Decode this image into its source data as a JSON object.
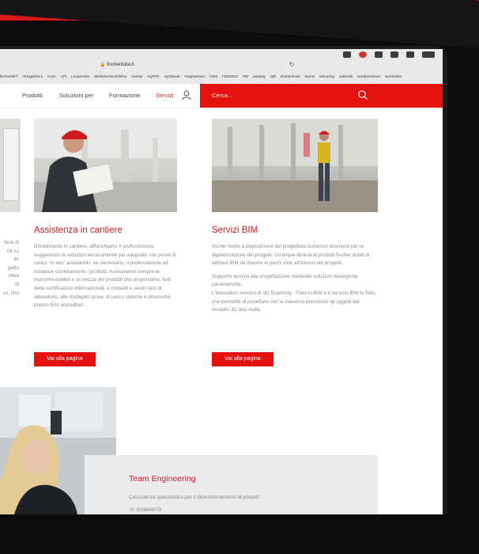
{
  "browser": {
    "url": "fischeritalia.it",
    "bookmarks": [
      "fischerNET",
      "GoogleDocs",
      "icons",
      "API",
      "Leoperman",
      "MediaServiceOnline",
      "mensa",
      "myFPS",
      "myDeliver",
      "Paginazione",
      "FDM",
      "FDM2022",
      "PM",
      "pixabay",
      "QR",
      "shutterstock",
      "teams",
      "teknoring",
      "settoriali",
      "wordpresseria",
      "wetransfer"
    ]
  },
  "nav": {
    "items": [
      "Prodotti",
      "Soluzioni per",
      "Formazione",
      "Servizi"
    ],
    "active_index": 3,
    "user_icon": "user-icon"
  },
  "search": {
    "placeholder": "Cerca...",
    "icon": "search-icon"
  },
  "left_fragment": {
    "lines": [
      "fase di",
      "",
      "nti su",
      "de",
      "getto",
      "ntiva",
      "di",
      "co, fino"
    ]
  },
  "services": [
    {
      "title": "Assistenza in cantiere",
      "paragraphs": [
        "Direttamente in cantiere, affianchiamo il professionista suggerendo le soluzioni tecnicamente più adeguate con prove di carico \"in situ\" assistendo, se necessario, il professionista ad installare correttamente i prodotti. Assicuriamo sempre la massima qualità e sicurezza dei prodotti che proponiamo, forti delle certificazioni internazionali, a costanti e severi test di laboratorio, alle molteplici prove di carico statiche e dinamiche presso Enti accreditati."
      ],
      "button": "Vai alla pagina"
    },
    {
      "title": "Servizi BIM",
      "paragraphs": [
        "fischer mette a disposizione del progettista numerosi strumenti per la digitalizzazione dei progetti. Un'ampia libreria di prodotti fischer dotati di attributi BIM da inserire in pochi click all'interno dei progetti.",
        "Supporto tecnico alla progettazione mediante soluzioni tipologiche parametriche.",
        "L'innovativo servizio di 3D Scanning - Field to BIM e il servizio BIM to field, che permette di proiettare con la massima precisione gli oggetti dal modello 3D alla realtà."
      ],
      "button": "Vai alla pagina"
    }
  ],
  "team": {
    "title": "Team Engineering",
    "description": "Consulenza specialistica per il dimensionamento di progetti",
    "phone": "800844078"
  },
  "colors": {
    "brand_red": "#e3120f",
    "text_grey": "#8a8a8a"
  }
}
